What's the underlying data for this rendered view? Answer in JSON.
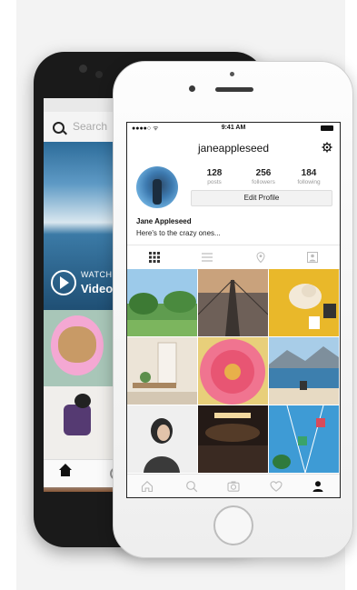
{
  "back_phone": {
    "search_placeholder": "Search",
    "watch_label": "WATCH",
    "video_label": "Video"
  },
  "status_bar": {
    "carrier": "●●●●○ ᯤ",
    "time": "9:41 AM"
  },
  "profile": {
    "username": "janeappleseed",
    "posts_count": "128",
    "posts_label": "posts",
    "followers_count": "256",
    "followers_label": "followers",
    "following_count": "184",
    "following_label": "following",
    "edit_profile_label": "Edit Profile",
    "display_name": "Jane Appleseed",
    "bio": "Here's to the crazy ones..."
  },
  "view_tabs": [
    "grid-icon",
    "list-icon",
    "location-pin-icon",
    "tagged-icon"
  ],
  "grid_photos": [
    {
      "name": "park-photo",
      "colors": [
        "#8fbfe3",
        "#6aa35a",
        "#3f7d3a"
      ]
    },
    {
      "name": "bridge-photo",
      "colors": [
        "#c7a57a",
        "#8a7060",
        "#4d4540"
      ]
    },
    {
      "name": "dog-yellow-photo",
      "colors": [
        "#e8b925",
        "#f0c83a",
        "#d4a21c"
      ]
    },
    {
      "name": "interior-photo",
      "colors": [
        "#eee7dc",
        "#cfc3b0",
        "#a48a6a"
      ]
    },
    {
      "name": "pink-flower-photo",
      "colors": [
        "#f27a95",
        "#e8506f",
        "#c93055"
      ]
    },
    {
      "name": "beach-photo",
      "colors": [
        "#9ec6e6",
        "#4f8fb8",
        "#e9dcc4"
      ]
    },
    {
      "name": "portrait-photo",
      "colors": [
        "#f2f2f2",
        "#d9d9d9",
        "#2a2a2a"
      ]
    },
    {
      "name": "concert-photo",
      "colors": [
        "#3a2a25",
        "#6a4a30",
        "#1a1412"
      ]
    },
    {
      "name": "carnival-photo",
      "colors": [
        "#4ca3d8",
        "#2d7fc0",
        "#3aa36a"
      ]
    }
  ],
  "tab_bar": [
    "home-icon",
    "search-icon",
    "camera-icon",
    "heart-icon",
    "profile-icon"
  ]
}
